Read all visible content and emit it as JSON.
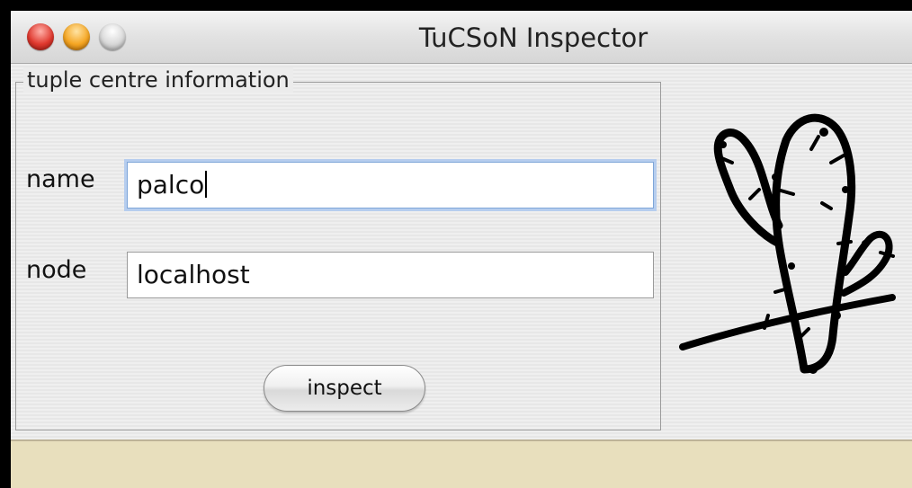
{
  "window": {
    "title": "TuCSoN Inspector"
  },
  "group": {
    "legend": "tuple centre information"
  },
  "fields": {
    "name_label": "name",
    "name_value": "palco",
    "node_label": "node",
    "node_value": "localhost"
  },
  "buttons": {
    "inspect_label": "inspect"
  },
  "icons": {
    "logo": "cactus-icon"
  },
  "colors": {
    "status_bar": "#e8dfbd",
    "focus_ring": "#b6cdee"
  }
}
